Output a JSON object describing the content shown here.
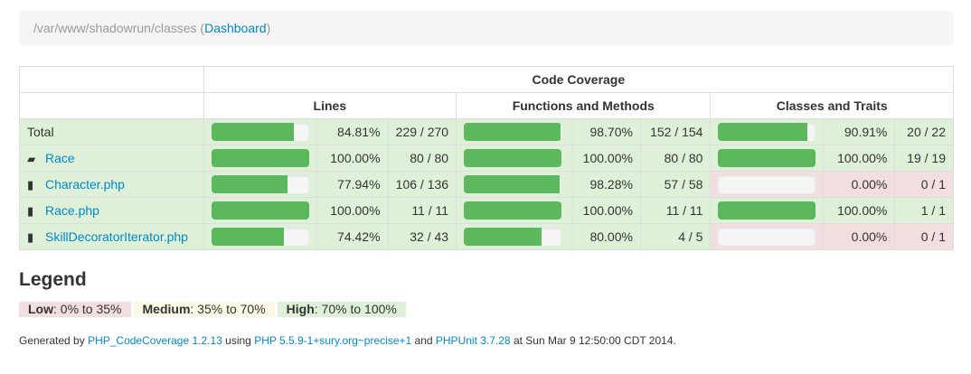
{
  "breadcrumb": {
    "path": "/var/www/shadowrun/classes",
    "open_paren": " (",
    "link": "Dashboard",
    "close_paren": ")"
  },
  "table": {
    "header_main": "Code Coverage",
    "headers": [
      "Lines",
      "Functions and Methods",
      "Classes and Traits"
    ],
    "rows": [
      {
        "name": "Total",
        "icon": "",
        "link": false,
        "lines": {
          "pct": "84.81%",
          "count": "229 / 270",
          "fill": 0.8481,
          "status": "success"
        },
        "functions": {
          "pct": "98.70%",
          "count": "152 / 154",
          "fill": 0.987,
          "status": "success"
        },
        "classes": {
          "pct": "90.91%",
          "count": "20 / 22",
          "fill": 0.9091,
          "status": "success"
        }
      },
      {
        "name": "Race",
        "icon": "folder-open-icon",
        "link": true,
        "lines": {
          "pct": "100.00%",
          "count": "80 / 80",
          "fill": 1.0,
          "status": "success"
        },
        "functions": {
          "pct": "100.00%",
          "count": "80 / 80",
          "fill": 1.0,
          "status": "success"
        },
        "classes": {
          "pct": "100.00%",
          "count": "19 / 19",
          "fill": 1.0,
          "status": "success"
        }
      },
      {
        "name": "Character.php",
        "icon": "file-icon",
        "link": true,
        "lines": {
          "pct": "77.94%",
          "count": "106 / 136",
          "fill": 0.7794,
          "status": "success"
        },
        "functions": {
          "pct": "98.28%",
          "count": "57 / 58",
          "fill": 0.9828,
          "status": "success"
        },
        "classes": {
          "pct": "0.00%",
          "count": "0 / 1",
          "fill": 0.0,
          "status": "danger"
        }
      },
      {
        "name": "Race.php",
        "icon": "file-icon",
        "link": true,
        "lines": {
          "pct": "100.00%",
          "count": "11 / 11",
          "fill": 1.0,
          "status": "success"
        },
        "functions": {
          "pct": "100.00%",
          "count": "11 / 11",
          "fill": 1.0,
          "status": "success"
        },
        "classes": {
          "pct": "100.00%",
          "count": "1 / 1",
          "fill": 1.0,
          "status": "success"
        }
      },
      {
        "name": "SkillDecoratorIterator.php",
        "icon": "file-icon",
        "link": true,
        "lines": {
          "pct": "74.42%",
          "count": "32 / 43",
          "fill": 0.7442,
          "status": "success"
        },
        "functions": {
          "pct": "80.00%",
          "count": "4 / 5",
          "fill": 0.8,
          "status": "success"
        },
        "classes": {
          "pct": "0.00%",
          "count": "0 / 1",
          "fill": 0.0,
          "status": "danger"
        }
      }
    ]
  },
  "legend": {
    "title": "Legend",
    "low_label": "Low",
    "low_range": ": 0% to 35%",
    "medium_label": "Medium",
    "medium_range": ": 35% to 70%",
    "high_label": "High",
    "high_range": ": 70% to 100%"
  },
  "footer": {
    "prefix": "Generated by ",
    "tool_link": "PHP_CodeCoverage 1.2.13",
    "using": " using ",
    "php_link": "PHP 5.5.9-1+sury.org~precise+1",
    "and": " and ",
    "phpunit_link": "PHPUnit 3.7.28",
    "suffix": " at Sun Mar 9 12:50:00 CDT 2014."
  },
  "colors": {
    "bar_fill": "#5cb85c",
    "success_bg": "#dff0d8",
    "danger_bg": "#f2dede",
    "warning_bg": "#fcf8e3",
    "link": "#0088cc"
  }
}
